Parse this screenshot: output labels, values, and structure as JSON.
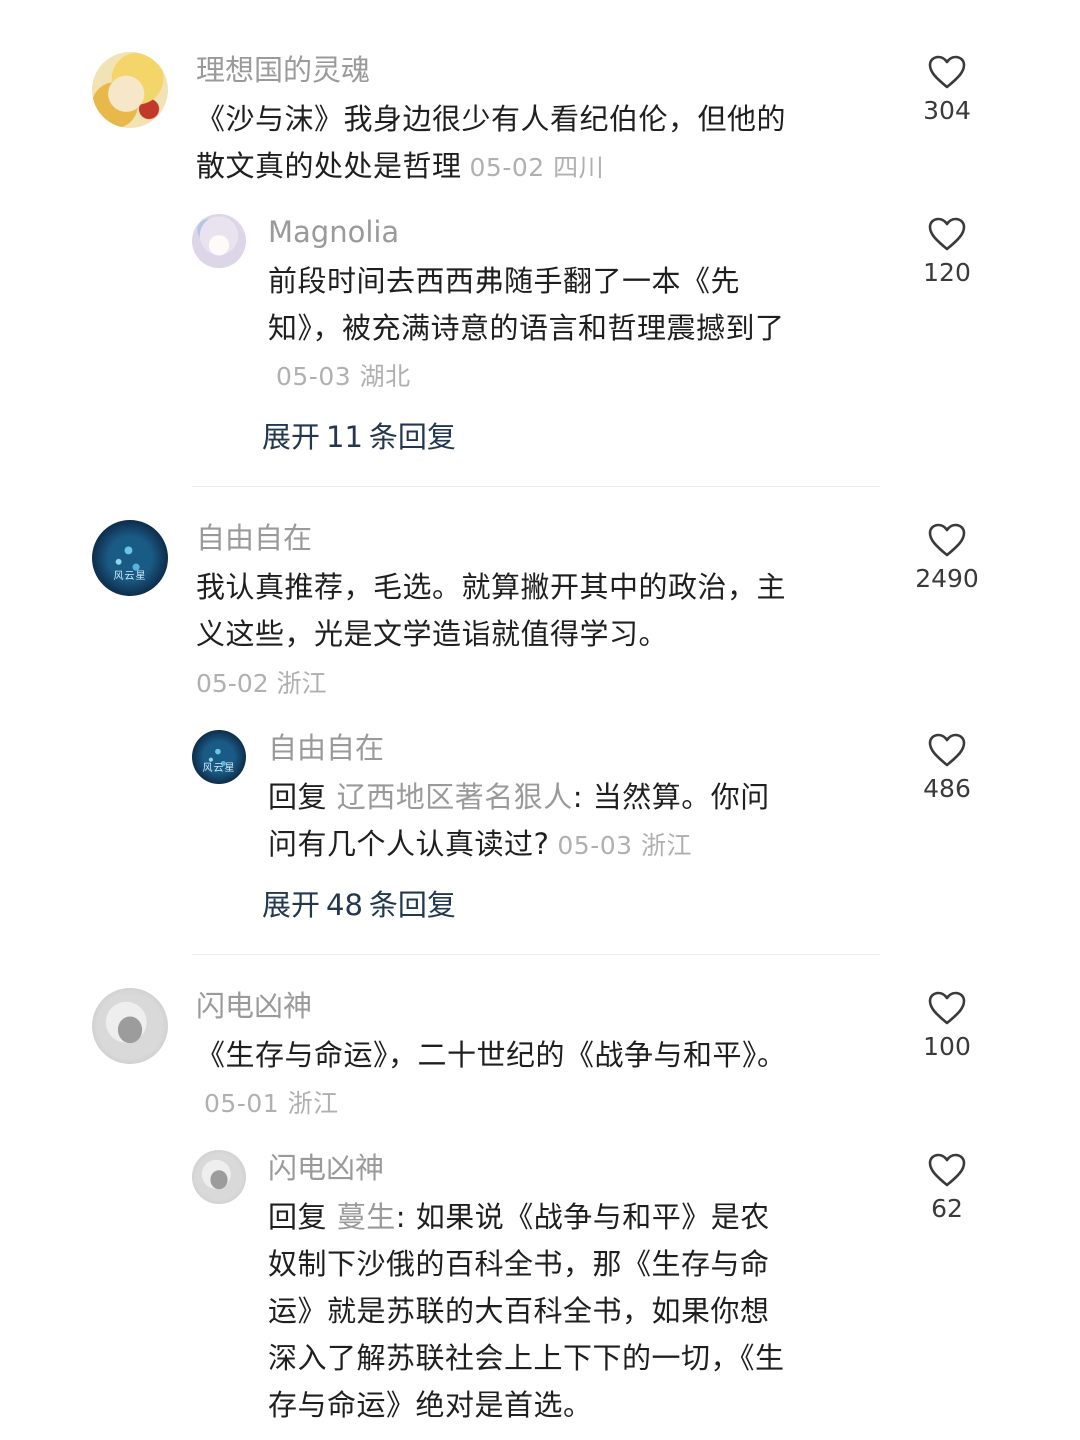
{
  "comments": [
    {
      "username": "理想国的灵魂",
      "text": "《沙与沫》我身边很少有人看纪伯伦，但他的散文真的处处是哲理",
      "meta": "05-02 四川",
      "likes": "304",
      "avatar": "anime-avatar-icon",
      "replies": [
        {
          "username": "Magnolia",
          "text": "前段时间去西西弗随手翻了一本《先知》，被充满诗意的语言和哲理震撼到了",
          "meta": "05-03 湖北",
          "likes": "120",
          "avatar": "girl-avatar-icon"
        }
      ],
      "expand": {
        "prefix": "展开",
        "count": "11",
        "suffix": "条回复"
      }
    },
    {
      "username": "自由自在",
      "text": "我认真推荐，毛选。就算撇开其中的政治，主义这些，光是文学造诣就值得学习。",
      "meta": "05-02 浙江",
      "likes": "2490",
      "avatar": "space-avatar-icon",
      "avatar_mark": "风云星",
      "replies": [
        {
          "username": "自由自在",
          "reply_prefix": "回复",
          "reply_target": "辽西地区著名狠人",
          "text": ": 当然算。你问问有几个人认真读过?",
          "meta": "05-03 浙江",
          "likes": "486",
          "avatar": "space-avatar-icon",
          "avatar_mark": "风云星"
        }
      ],
      "expand": {
        "prefix": "展开",
        "count": "48",
        "suffix": "条回复"
      }
    },
    {
      "username": "闪电凶神",
      "text": "《生存与命运》，二十世纪的《战争与和平》。",
      "meta": "05-01 浙江",
      "likes": "100",
      "avatar": "car-avatar-icon",
      "replies": [
        {
          "username": "闪电凶神",
          "reply_prefix": "回复",
          "reply_target": "蔓生",
          "text": ": 如果说《战争与和平》是农奴制下沙俄的百科全书，那《生存与命运》就是苏联的大百科全书，如果你想深入了解苏联社会上上下下的一切，《生存与命运》绝对是首选。",
          "likes": "62",
          "avatar": "car-avatar-icon"
        }
      ]
    }
  ]
}
